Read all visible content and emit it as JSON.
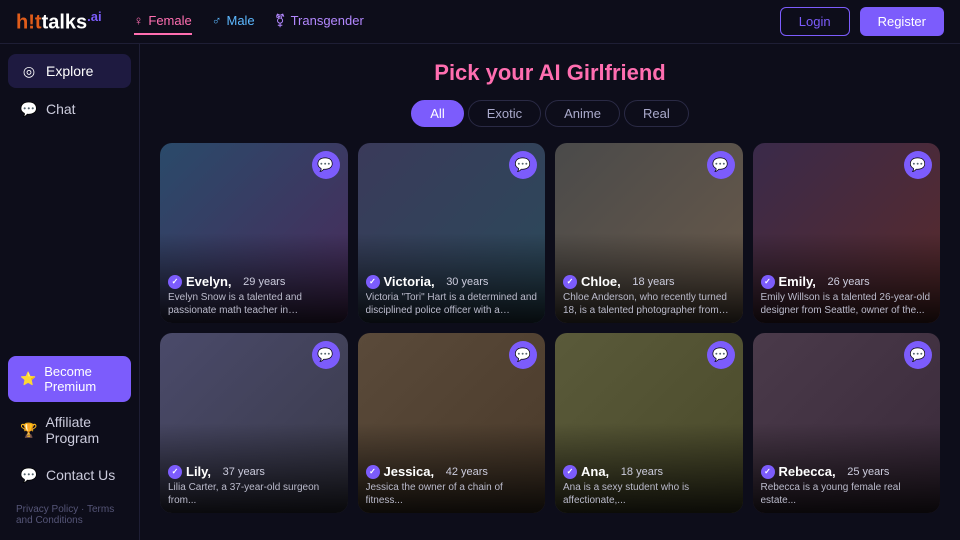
{
  "header": {
    "logo_hot": "h!t",
    "logo_rest": "talks.ai",
    "gender_tabs": [
      {
        "label": "Female",
        "icon": "♀",
        "class": "active female"
      },
      {
        "label": "Male",
        "icon": "♂",
        "class": "male"
      },
      {
        "label": "Transgender",
        "icon": "⚧",
        "class": "transgender"
      }
    ],
    "login_label": "Login",
    "register_label": "Register"
  },
  "sidebar": {
    "items": [
      {
        "label": "Explore",
        "icon": "◎",
        "active": true
      },
      {
        "label": "Chat",
        "icon": "💬",
        "active": false
      }
    ],
    "premium_label": "Become Premium",
    "premium_icon": "⭐",
    "affiliate_label": "Affiliate Program",
    "affiliate_icon": "🏆",
    "contact_label": "Contact Us",
    "contact_icon": "💬",
    "footer_privacy": "Privacy Policy",
    "footer_terms": "Terms and Conditions"
  },
  "main": {
    "title_normal": "Pick your AI ",
    "title_accent": "Girlfriend",
    "filter_tabs": [
      {
        "label": "All",
        "active": true
      },
      {
        "label": "Exotic",
        "active": false
      },
      {
        "label": "Anime",
        "active": false
      },
      {
        "label": "Real",
        "active": false
      }
    ],
    "cards_row1": [
      {
        "name": "Evelyn,",
        "age": "29 years",
        "desc": "Evelyn Snow is a talented and passionate math teacher in Vancouver,..."
      },
      {
        "name": "Victoria,",
        "age": "30 years",
        "desc": "Victoria \"Tori\" Hart is a determined and disciplined police officer with a passion..."
      },
      {
        "name": "Chloe,",
        "age": "18 years",
        "desc": "Chloe Anderson, who recently turned 18, is a talented photographer from Sydne..."
      },
      {
        "name": "Emily,",
        "age": "26 years",
        "desc": "Emily Willson is a talented 26-year-old designer from Seattle, owner of the..."
      }
    ],
    "cards_row2": [
      {
        "name": "Lily,",
        "age": "37 years",
        "desc": "Lilia Carter, a 37-year-old surgeon from..."
      },
      {
        "name": "Jessica,",
        "age": "42 years",
        "desc": "Jessica the owner of a chain of fitness..."
      },
      {
        "name": "Ana,",
        "age": "18 years",
        "desc": "Ana is a sexy student who is affectionate,..."
      },
      {
        "name": "Rebecca,",
        "age": "25 years",
        "desc": "Rebecca is a young female real estate..."
      }
    ]
  }
}
